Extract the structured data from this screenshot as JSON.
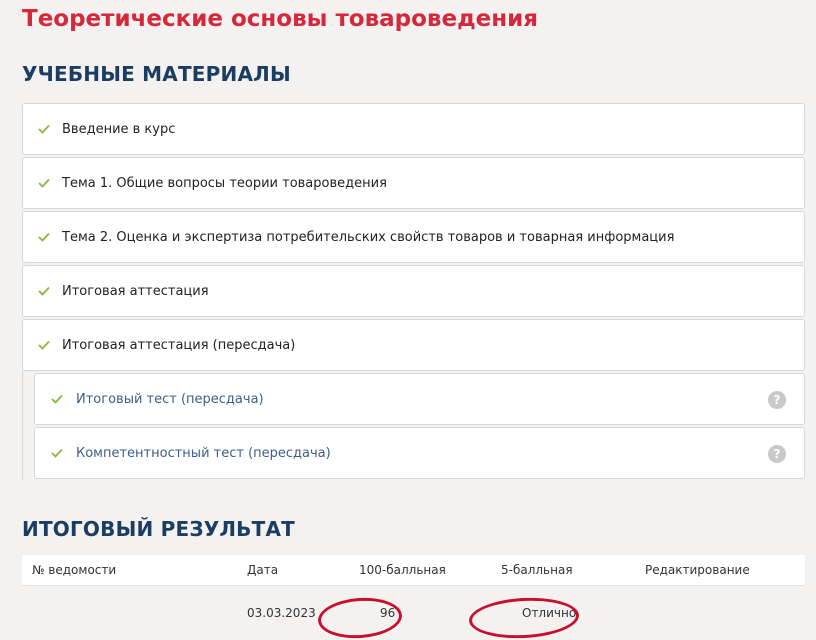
{
  "course": {
    "title": "Теоретические основы товароведения"
  },
  "materials": {
    "heading": "УЧЕБНЫЕ МАТЕРИАЛЫ",
    "items": [
      {
        "label": "Введение в курс",
        "completed": true
      },
      {
        "label": "Тема 1. Общие вопросы теории товароведения",
        "completed": true
      },
      {
        "label": "Тема 2. Оценка и экспертиза потребительских свойств товаров и товарная информация",
        "completed": true
      },
      {
        "label": "Итоговая аттестация",
        "completed": true
      },
      {
        "label": "Итоговая аттестация (пересдача)",
        "completed": true
      }
    ],
    "subitems": [
      {
        "label": "Итоговый тест (пересдача)",
        "completed": true,
        "help": "?"
      },
      {
        "label": "Компетентностный тест (пересдача)",
        "completed": true,
        "help": "?"
      }
    ]
  },
  "result": {
    "heading": "ИТОГОВЫЙ РЕЗУЛЬТАТ",
    "columns": [
      "№ ведомости",
      "Дата",
      "100-балльная",
      "5-балльная",
      "Редактирование"
    ],
    "rows": [
      {
        "sheet_no": "",
        "date": "03.03.2023",
        "score100": "96",
        "score5": "Отлично",
        "edit": ""
      }
    ]
  },
  "colors": {
    "title": "#d6283b",
    "heading": "#1c3d62",
    "check": "#8bb53a",
    "link": "#3a5f86",
    "annotation": "#c8102e"
  },
  "icons": {
    "check": "check-icon",
    "help": "help-icon"
  }
}
